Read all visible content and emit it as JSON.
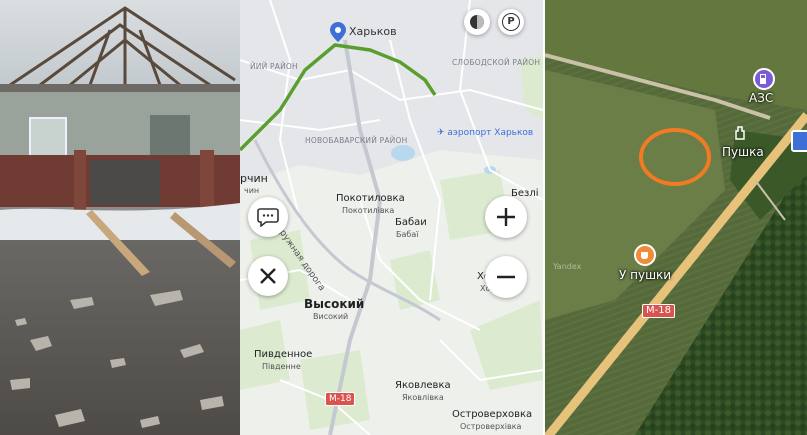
{
  "map": {
    "city": "Харьков",
    "districts": [
      "СЛОБОДСКОЙ РАЙОН",
      "НОВОБАВАРСКИЙ РАЙОН",
      "ЙИЙ РАЙОН"
    ],
    "airport": "аэропорт Харьков",
    "places": [
      {
        "name": "Покотиловка",
        "sub": "Покотилівка"
      },
      {
        "name": "Бабаи",
        "sub": "Бабаї"
      },
      {
        "name": "Высокий",
        "sub": "Високий"
      },
      {
        "name": "Пивденное",
        "sub": "Південне"
      },
      {
        "name": "Яковлевка",
        "sub": "Яковлівка"
      },
      {
        "name": "Островерховка",
        "sub": "Островерхівка"
      },
      {
        "name": "Безлі",
        "sub": ""
      },
      {
        "name": "Хо",
        "sub": "Хорошеве"
      },
      {
        "name": "рчин",
        "sub": "чин"
      }
    ],
    "road_label": "Окружная дорога",
    "route_badge": "М-18",
    "parking_label": "P",
    "icons": [
      "location-pin-icon",
      "chat-icon",
      "close-icon",
      "zoom-in-icon",
      "zoom-out-icon",
      "traffic-icon",
      "parking-icon"
    ]
  },
  "satellite": {
    "gas_station": "АЗС",
    "poi": "Пушка",
    "cafe": "У пушки",
    "route_badge": "М-18",
    "watermark": "Yandex",
    "colors": {
      "circle": "#f07b22",
      "road": "#e7c27a"
    }
  }
}
